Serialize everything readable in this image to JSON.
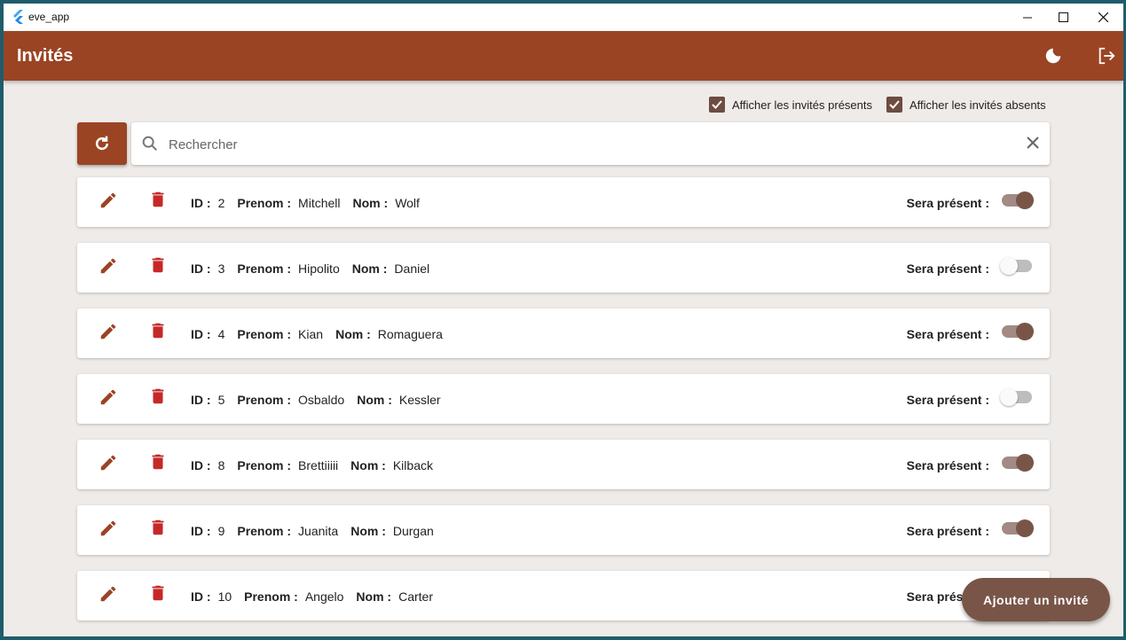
{
  "window": {
    "title": "eve_app"
  },
  "appbar": {
    "title": "Invités",
    "theme_icon": "dark-mode-icon",
    "logout_icon": "logout-icon"
  },
  "filters": {
    "present": {
      "label": "Afficher les invités présents",
      "checked": true
    },
    "absent": {
      "label": "Afficher les invités absents",
      "checked": true
    }
  },
  "search": {
    "placeholder": "Rechercher",
    "value": ""
  },
  "labels": {
    "id": "ID :",
    "prenom": "Prenom :",
    "nom": "Nom :",
    "present": "Sera présent :"
  },
  "guests": [
    {
      "id": "2",
      "prenom": "Mitchell",
      "nom": "Wolf",
      "present": true
    },
    {
      "id": "3",
      "prenom": "Hipolito",
      "nom": "Daniel",
      "present": false
    },
    {
      "id": "4",
      "prenom": "Kian",
      "nom": "Romaguera",
      "present": true
    },
    {
      "id": "5",
      "prenom": "Osbaldo",
      "nom": "Kessler",
      "present": false
    },
    {
      "id": "8",
      "prenom": "Brettiiiii",
      "nom": "Kilback",
      "present": true
    },
    {
      "id": "9",
      "prenom": "Juanita",
      "nom": "Durgan",
      "present": true
    },
    {
      "id": "10",
      "prenom": "Angelo",
      "nom": "Carter",
      "present": false
    }
  ],
  "fab": {
    "label": "Ajouter un invité"
  },
  "colors": {
    "appbar": "#9a4424",
    "background": "#efebe8",
    "accent": "#795548",
    "delete": "#c62828"
  }
}
